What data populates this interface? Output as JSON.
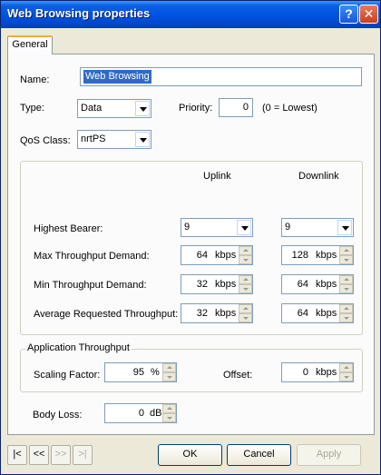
{
  "window": {
    "title": "Web Browsing properties"
  },
  "titlebar_buttons": {
    "help": "?",
    "close": "✕"
  },
  "tabs": [
    {
      "label": "General"
    }
  ],
  "form": {
    "name_label": "Name:",
    "name_value": "Web Browsing",
    "type_label": "Type:",
    "type_value": "Data",
    "priority_label": "Priority:",
    "priority_value": "0",
    "priority_hint": "(0 = Lowest)",
    "qos_label": "QoS Class:",
    "qos_value": "nrtPS"
  },
  "throughput_table": {
    "uplink_header": "Uplink",
    "downlink_header": "Downlink",
    "highest_bearer": {
      "label": "Highest Bearer:",
      "uplink": "9",
      "downlink": "9"
    },
    "max_demand": {
      "label": "Max Throughput Demand:",
      "uplink": "64",
      "uplink_unit": "kbps",
      "downlink": "128",
      "downlink_unit": "kbps"
    },
    "min_demand": {
      "label": "Min Throughput Demand:",
      "uplink": "32",
      "uplink_unit": "kbps",
      "downlink": "64",
      "downlink_unit": "kbps"
    },
    "avg_requested": {
      "label": "Average Requested Throughput:",
      "uplink": "32",
      "uplink_unit": "kbps",
      "downlink": "64",
      "downlink_unit": "kbps"
    }
  },
  "application_throughput": {
    "title": "Application Throughput",
    "scaling_label": "Scaling Factor:",
    "scaling_value": "95",
    "scaling_unit": "%",
    "offset_label": "Offset:",
    "offset_value": "0",
    "offset_unit": "kbps"
  },
  "body_loss": {
    "label": "Body Loss:",
    "value": "0",
    "unit": "dB"
  },
  "nav": {
    "first": "|<",
    "prev": "<<",
    "next": ">>",
    "last": ">|"
  },
  "buttons": {
    "ok": "OK",
    "cancel": "Cancel",
    "apply": "Apply"
  }
}
